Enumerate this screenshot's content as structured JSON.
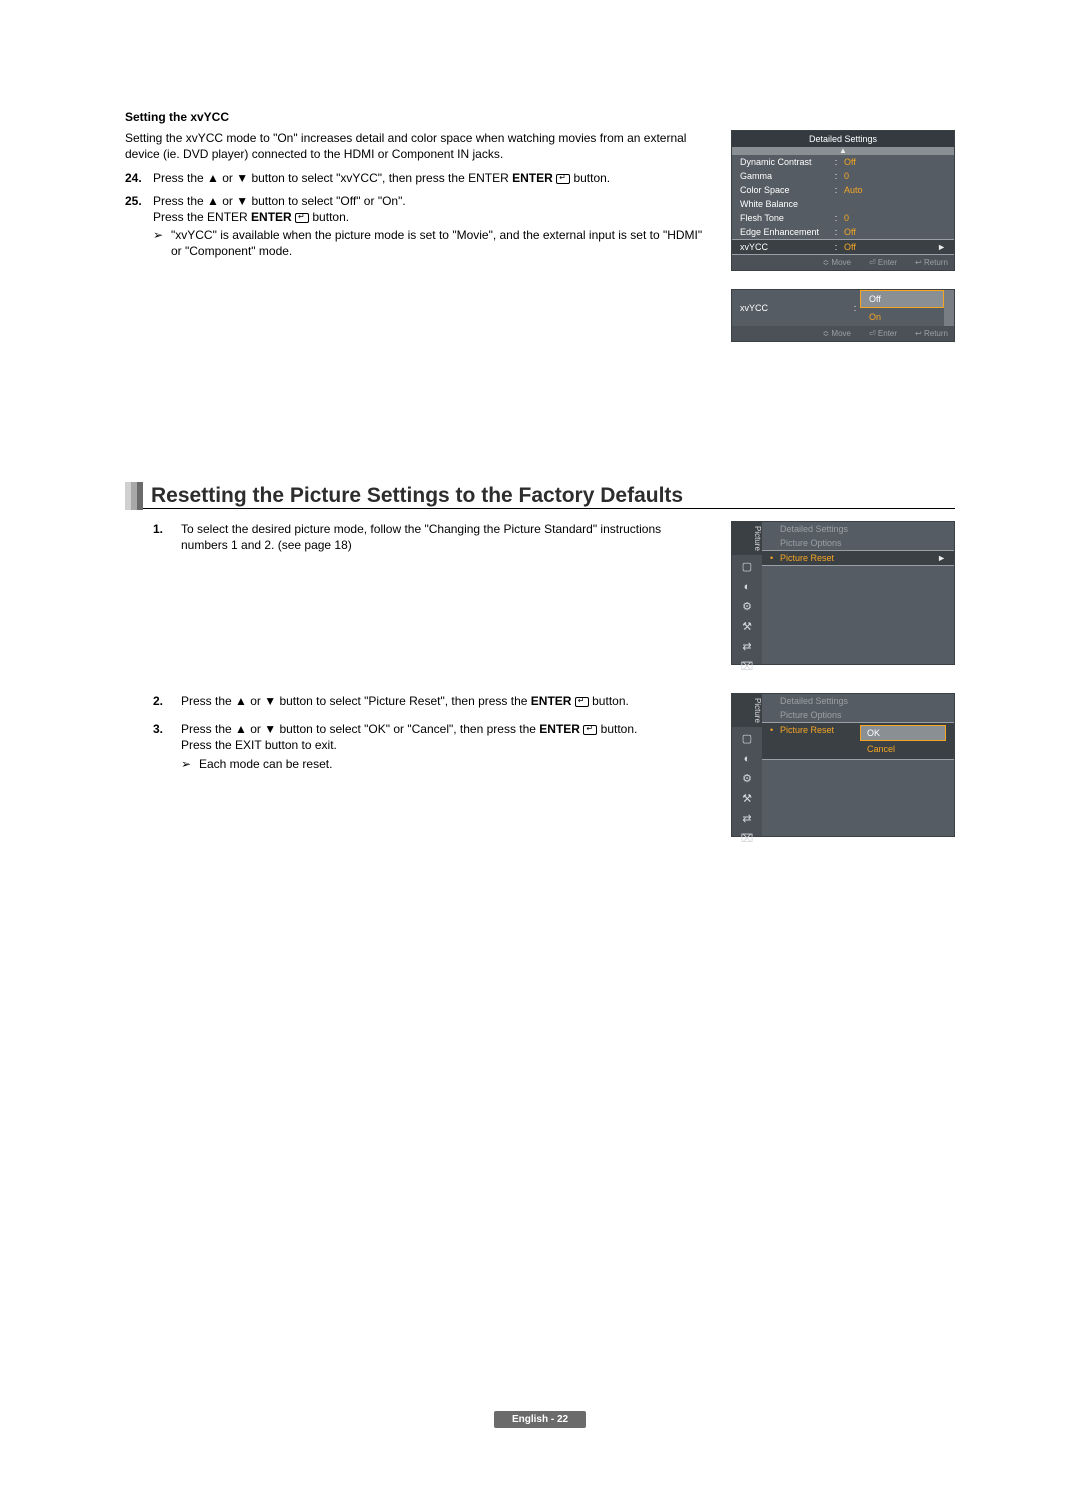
{
  "xvycc_section": {
    "heading": "Setting the xvYCC",
    "intro": "Setting the xvYCC mode to \"On\" increases detail and color space when watching movies from an external device (ie. DVD player) connected to the HDMI or Component IN jacks.",
    "step24_num": "24.",
    "step24": "Press the ▲ or ▼ button to select \"xvYCC\", then press the ENTER ",
    "step24_tail": " button.",
    "step25_num": "25.",
    "step25_a": "Press the ▲ or ▼ button to select \"Off\" or \"On\".",
    "step25_b_pre": "Press the ENTER ",
    "step25_b_post": " button.",
    "note_icon": "➢",
    "note": "\"xvYCC\" is available when the picture mode is set to \"Movie\", and the external input is set to \"HDMI\" or \"Component\" mode."
  },
  "osd1": {
    "title": "Detailed Settings",
    "scroll_up": "▲",
    "rows": {
      "r0_lbl": "Dynamic Contrast",
      "r0_val": "Off",
      "r1_lbl": "Gamma",
      "r1_val": "0",
      "r2_lbl": "Color Space",
      "r2_val": "Auto",
      "r3_lbl": "White Balance",
      "r3_val": "",
      "r4_lbl": "Flesh Tone",
      "r4_val": "0",
      "r5_lbl": "Edge Enhancement",
      "r5_val": "Off",
      "r6_lbl": "xvYCC",
      "r6_val": "Off"
    },
    "arrow_r": "►",
    "footer_move": "Move",
    "footer_enter": "Enter",
    "footer_return": "Return",
    "move_glyph": "≎",
    "enter_glyph": "⏎",
    "return_glyph": "↩"
  },
  "osd2": {
    "label": "xvYCC",
    "colon": ":",
    "opt_off": "Off",
    "opt_on": "On",
    "footer_move": "Move",
    "footer_enter": "Enter",
    "footer_return": "Return"
  },
  "reset_section": {
    "title": "Resetting the Picture Settings to the Factory Defaults",
    "step1_num": "1.",
    "step1": "To select the desired picture mode, follow the \"Changing the Picture Standard\" instructions numbers 1 and 2. (see page 18)",
    "step2_num": "2.",
    "step2_pre": "Press the ▲ or ▼ button to select \"Picture Reset\", then press the ",
    "step2_bold": "ENTER ",
    "step2_post": " button.",
    "step3_num": "3.",
    "step3_pre": "Press the ▲ or ▼ button to select \"OK\" or \"Cancel\", then press the ",
    "step3_bold": "ENTER ",
    "step3_post": " button.",
    "step3_exit": "Press the EXIT button to exit.",
    "note_icon": "➢",
    "step3_note": "Each mode can be reset."
  },
  "osd3": {
    "side_label": "Picture",
    "row0": "Detailed Settings",
    "row1": "Picture Options",
    "row2": "Picture Reset",
    "arrow_r": "►"
  },
  "osd4": {
    "side_label": "Picture",
    "row0": "Detailed Settings",
    "row1": "Picture Options",
    "row2": "Picture Reset",
    "opt_ok": "OK",
    "opt_cancel": "Cancel"
  },
  "footer": {
    "text": "English - 22"
  },
  "icons": {
    "tv": "▢",
    "sound": "◐",
    "channel": "⚙",
    "setup": "⚒",
    "input": "⇄",
    "app": "⌧"
  }
}
